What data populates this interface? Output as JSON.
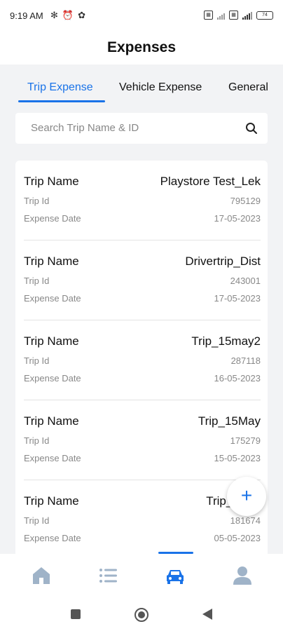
{
  "status_bar": {
    "time": "9:19 AM",
    "battery": "74"
  },
  "header": {
    "title": "Expenses"
  },
  "tabs": [
    {
      "label": "Trip Expense",
      "active": true
    },
    {
      "label": "Vehicle Expense",
      "active": false
    },
    {
      "label": "General",
      "active": false
    }
  ],
  "search": {
    "placeholder": "Search Trip Name & ID"
  },
  "labels": {
    "trip_name": "Trip Name",
    "trip_id": "Trip Id",
    "expense_date": "Expense Date"
  },
  "expenses": [
    {
      "trip_name": "Playstore Test_Lek",
      "trip_id": "795129",
      "expense_date": "17-05-2023"
    },
    {
      "trip_name": "Drivertrip_Dist",
      "trip_id": "243001",
      "expense_date": "17-05-2023"
    },
    {
      "trip_name": "Trip_15may2",
      "trip_id": "287118",
      "expense_date": "16-05-2023"
    },
    {
      "trip_name": "Trip_15May",
      "trip_id": "175279",
      "expense_date": "15-05-2023"
    },
    {
      "trip_name": "Trip_Drive",
      "trip_id": "181674",
      "expense_date": "05-05-2023"
    }
  ],
  "fab": {
    "label": "+"
  },
  "bottom_nav": [
    {
      "icon": "home-icon",
      "active": false
    },
    {
      "icon": "list-icon",
      "active": false
    },
    {
      "icon": "car-icon",
      "active": true
    },
    {
      "icon": "profile-icon",
      "active": false
    }
  ],
  "colors": {
    "accent": "#1a73e8",
    "inactive_icon": "#9fb3c8",
    "background": "#f2f3f5"
  }
}
